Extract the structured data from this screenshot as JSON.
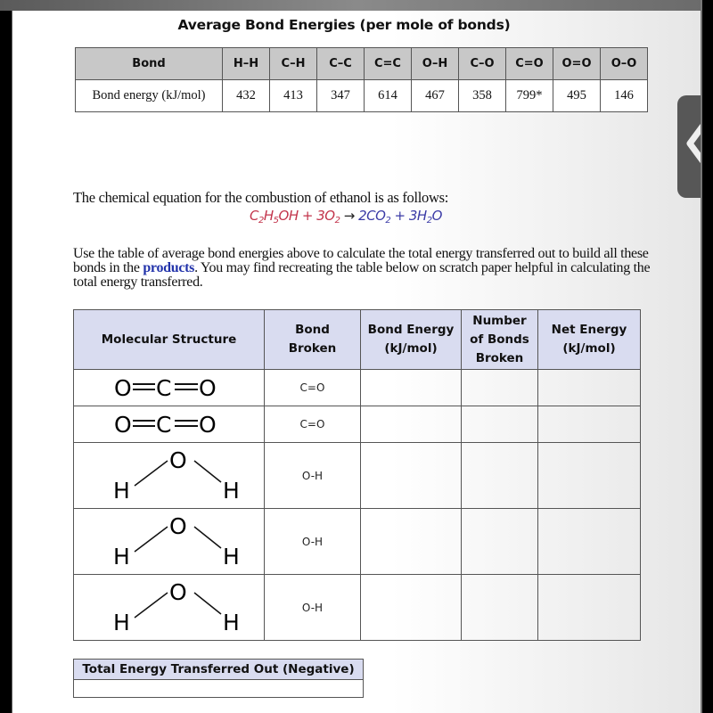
{
  "bond_energy_table": {
    "title": "Average Bond Energies (per mole of bonds)",
    "header_label": "Bond",
    "row_label": "Bond energy (kJ/mol)",
    "bonds": [
      {
        "bond": "H–H",
        "energy": "432"
      },
      {
        "bond": "C–H",
        "energy": "413"
      },
      {
        "bond": "C–C",
        "energy": "347"
      },
      {
        "bond": "C=C",
        "energy": "614"
      },
      {
        "bond": "O–H",
        "energy": "467"
      },
      {
        "bond": "C–O",
        "energy": "358"
      },
      {
        "bond": "C=O",
        "energy": "799*"
      },
      {
        "bond": "O=O",
        "energy": "495"
      },
      {
        "bond": "O–O",
        "energy": "146"
      }
    ]
  },
  "intro_text": "The chemical equation for the combustion of ethanol is as follows:",
  "equation": {
    "reactants": {
      "ethanol": [
        "C",
        "2",
        "H",
        "5",
        "OH"
      ],
      "plus": " + ",
      "oxygen": [
        "3O",
        "2"
      ]
    },
    "arrow": " → ",
    "products": {
      "co2": [
        "2CO",
        "2"
      ],
      "plus": " + ",
      "water": [
        "3H",
        "2",
        "O"
      ]
    },
    "reactant_color": "#c2334a",
    "product_color": "#3a3aa6"
  },
  "instructions": {
    "before": "Use the table of average bond energies above to calculate the total energy transferred out to build all these bonds in the ",
    "highlight": "products",
    "after": ". You may find recreating the table below on scratch paper helpful in calculating the total energy transferred."
  },
  "work_table": {
    "headers": [
      "Molecular Structure",
      "Bond Broken",
      "Bond Energy (kJ/mol)",
      "Number of Bonds Broken",
      "Net Energy (kJ/mol)"
    ],
    "rows": [
      {
        "structure": "O=C=O",
        "molecule": "CO2",
        "bond_broken": "C=O",
        "bond_energy": "",
        "num_bonds": "",
        "net_energy": ""
      },
      {
        "structure": "O=C=O",
        "molecule": "CO2",
        "bond_broken": "C=O",
        "bond_energy": "",
        "num_bonds": "",
        "net_energy": ""
      },
      {
        "structure": "H-O-H",
        "molecule": "H2O",
        "bond_broken": "O-H",
        "bond_energy": "",
        "num_bonds": "",
        "net_energy": ""
      },
      {
        "structure": "H-O-H",
        "molecule": "H2O",
        "bond_broken": "O-H",
        "bond_energy": "",
        "num_bonds": "",
        "net_energy": ""
      },
      {
        "structure": "H-O-H",
        "molecule": "H2O",
        "bond_broken": "O-H",
        "bond_energy": "",
        "num_bonds": "",
        "net_energy": ""
      }
    ],
    "atoms": {
      "oxygen": "O",
      "carbon": "C",
      "hydrogen": "H"
    }
  },
  "total_table": {
    "header": "Total Energy Transferred Out (Negative)",
    "value": ""
  },
  "side_tab": {
    "icon": "chevron-left-icon"
  },
  "colors": {
    "work_header_bg": "#d9dcf0",
    "bond_header_bg": "#c8c8c8",
    "products_link": "#2233aa"
  }
}
